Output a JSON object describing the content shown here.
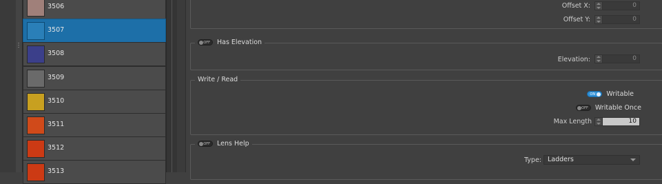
{
  "items": [
    {
      "id": "3506",
      "thumb_color": "#a0807a",
      "selected": false
    },
    {
      "id": "3507",
      "thumb_color": "#2a7fb8",
      "selected": true
    },
    {
      "id": "3508",
      "thumb_color": "#3b3f8a",
      "selected": false
    },
    {
      "id": "3509",
      "thumb_color": "#6a6a6a",
      "selected": false
    },
    {
      "id": "3510",
      "thumb_color": "#c8a020",
      "selected": false
    },
    {
      "id": "3511",
      "thumb_color": "#d04a1a",
      "selected": false
    },
    {
      "id": "3512",
      "thumb_color": "#cc3a14",
      "selected": false
    },
    {
      "id": "3513",
      "thumb_color": "#cc3a14",
      "selected": false
    }
  ],
  "offset": {
    "x_label": "Offset X:",
    "x_value": "0",
    "y_label": "Offset Y:",
    "y_value": "0"
  },
  "has_elevation": {
    "title": "Has Elevation",
    "toggle_text": "OFF",
    "elevation_label": "Elevation:",
    "elevation_value": "0"
  },
  "write_read": {
    "title": "Write / Read",
    "writable_label": "Writable",
    "writable_toggle": "ON",
    "writable_once_label": "Writable Once",
    "writable_once_toggle": "OFF",
    "max_length_label": "Max Length",
    "max_length_value": "10"
  },
  "lens_help": {
    "title": "Lens Help",
    "toggle_text": "OFF",
    "type_label": "Type:",
    "type_value": "Ladders"
  },
  "colors": {
    "accent": "#1d6fa8",
    "toggle_on": "#2e8fd6"
  }
}
